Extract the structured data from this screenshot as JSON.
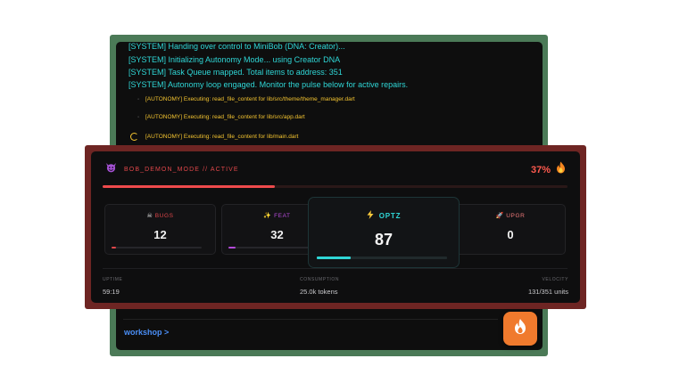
{
  "terminal": {
    "system_lines": [
      "[SYSTEM] Handing over control to MiniBob (DNA: Creator)...",
      "[SYSTEM] Initializing Autonomy Mode... using Creator DNA",
      "[SYSTEM] Task Queue mapped. Total items to address: 351",
      "[SYSTEM] Autonomy loop engaged. Monitor the pulse below for active repairs."
    ],
    "tasks": [
      "[AUTONOMY] Executing: read_file_content for lib/src/theme/theme_manager.dart",
      "[AUTONOMY] Executing: read_file_content for lib/src/app.dart",
      "[AUTONOMY] Executing: read_file_content for lib/main.dart"
    ],
    "workshop_link": "workshop >"
  },
  "demon_panel": {
    "title": "BOB_DEMON_MODE // ACTIVE",
    "title_icon": "devil-face-icon",
    "percent": "37%",
    "percent_icon": "fire-icon",
    "progress": 0.37,
    "cards": {
      "bugs": {
        "label": "BUGS",
        "icon": "skull-icon",
        "value": "12",
        "color": "#e0474a",
        "progress": 0.05
      },
      "feat": {
        "label": "FEAT",
        "icon": "sparkles-icon",
        "value": "32",
        "color": "#b44ad9",
        "progress": 0.08
      },
      "optz": {
        "label": "OPTZ",
        "icon": "lightning-icon",
        "value": "87",
        "color": "#2fd6d6",
        "progress": 0.26
      },
      "upgr": {
        "label": "UPGR",
        "icon": "rocket-icon",
        "value": "0",
        "color": "#f07a7a",
        "progress": 0
      }
    },
    "footer": {
      "uptime_label": "UPTIME",
      "uptime_value": "59:19",
      "tokens_label": "CONSUMPTION",
      "tokens_value": "25.0k tokens",
      "velocity_label": "VELOCITY",
      "velocity_value": "131/351 units"
    }
  },
  "fab": {
    "icon": "flame-icon"
  }
}
